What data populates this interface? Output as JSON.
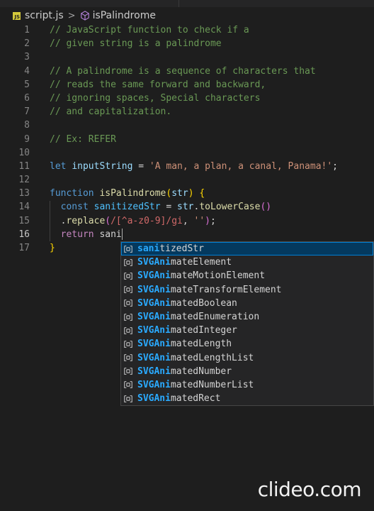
{
  "breadcrumb": {
    "file_badge": "JS",
    "file": "script.js",
    "separator": ">",
    "symbol": "isPalindrome"
  },
  "editor": {
    "active_line": 16,
    "lines": [
      {
        "n": "1",
        "tokens": [
          {
            "t": "// JavaScript function to check if a",
            "c": "c-comment"
          }
        ]
      },
      {
        "n": "2",
        "tokens": [
          {
            "t": "// given string is a palindrome",
            "c": "c-comment"
          }
        ]
      },
      {
        "n": "3",
        "tokens": []
      },
      {
        "n": "4",
        "tokens": [
          {
            "t": "// A palindrome is a sequence of characters that",
            "c": "c-comment"
          }
        ]
      },
      {
        "n": "5",
        "tokens": [
          {
            "t": "// reads the same forward and backward,",
            "c": "c-comment"
          }
        ]
      },
      {
        "n": "6",
        "tokens": [
          {
            "t": "// ignoring spaces, Special characters",
            "c": "c-comment"
          }
        ]
      },
      {
        "n": "7",
        "tokens": [
          {
            "t": "// and capitalization.",
            "c": "c-comment"
          }
        ]
      },
      {
        "n": "8",
        "tokens": []
      },
      {
        "n": "9",
        "tokens": [
          {
            "t": "// Ex: REFER",
            "c": "c-comment"
          }
        ]
      },
      {
        "n": "10",
        "tokens": []
      },
      {
        "n": "11",
        "tokens": [
          {
            "t": "let ",
            "c": "c-kw"
          },
          {
            "t": "inputString",
            "c": "c-var"
          },
          {
            "t": " = ",
            "c": "c-plain"
          },
          {
            "t": "'A man, a plan, a canal, Panama!'",
            "c": "c-str"
          },
          {
            "t": ";",
            "c": "c-plain"
          }
        ]
      },
      {
        "n": "12",
        "tokens": []
      },
      {
        "n": "13",
        "tokens": [
          {
            "t": "function ",
            "c": "c-kw"
          },
          {
            "t": "isPalindrome",
            "c": "c-fn"
          },
          {
            "t": "(",
            "c": "c-brace"
          },
          {
            "t": "str",
            "c": "c-var"
          },
          {
            "t": ")",
            "c": "c-brace"
          },
          {
            "t": " ",
            "c": "c-plain"
          },
          {
            "t": "{",
            "c": "c-brace"
          }
        ]
      },
      {
        "n": "14",
        "tokens": [
          {
            "t": "  const ",
            "c": "c-kw"
          },
          {
            "t": "sanitizedStr",
            "c": "c-const"
          },
          {
            "t": " = ",
            "c": "c-plain"
          },
          {
            "t": "str",
            "c": "c-var"
          },
          {
            "t": ".",
            "c": "c-plain"
          },
          {
            "t": "toLowerCase",
            "c": "c-fn"
          },
          {
            "t": "()",
            "c": "c-brace2"
          }
        ]
      },
      {
        "n": "15",
        "tokens": [
          {
            "t": "  .",
            "c": "c-plain"
          },
          {
            "t": "replace",
            "c": "c-fn"
          },
          {
            "t": "(",
            "c": "c-brace2"
          },
          {
            "t": "/[^a-z0-9]/gi",
            "c": "c-re"
          },
          {
            "t": ", ",
            "c": "c-plain"
          },
          {
            "t": "''",
            "c": "c-str"
          },
          {
            "t": ")",
            "c": "c-brace2"
          },
          {
            "t": ";",
            "c": "c-plain"
          }
        ]
      },
      {
        "n": "16",
        "tokens": [
          {
            "t": "  return ",
            "c": "c-ctrl"
          },
          {
            "t": "sani",
            "c": "c-plain"
          }
        ],
        "cursor": true
      },
      {
        "n": "17",
        "tokens": [
          {
            "t": "}",
            "c": "c-brace"
          }
        ]
      }
    ]
  },
  "suggestions": {
    "icon": "symbol-variable-icon",
    "items": [
      {
        "match": "sani",
        "rest": "tizedStr",
        "selected": true
      },
      {
        "match": "SVGAni",
        "rest": "mateElement"
      },
      {
        "match": "SVGAni",
        "rest": "mateMotionElement"
      },
      {
        "match": "SVGAni",
        "rest": "mateTransformElement"
      },
      {
        "match": "SVGAni",
        "rest": "matedBoolean"
      },
      {
        "match": "SVGAni",
        "rest": "matedEnumeration"
      },
      {
        "match": "SVGAni",
        "rest": "matedInteger"
      },
      {
        "match": "SVGAni",
        "rest": "matedLength"
      },
      {
        "match": "SVGAni",
        "rest": "matedLengthList"
      },
      {
        "match": "SVGAni",
        "rest": "matedNumber"
      },
      {
        "match": "SVGAni",
        "rest": "matedNumberList"
      },
      {
        "match": "SVGAni",
        "rest": "matedRect"
      }
    ]
  },
  "watermark": "clideo.com",
  "colors": {
    "background": "#1e1e1e",
    "comment": "#6a9955",
    "keyword": "#569cd6",
    "match_highlight": "#2aaaff",
    "selection": "#04395e"
  }
}
